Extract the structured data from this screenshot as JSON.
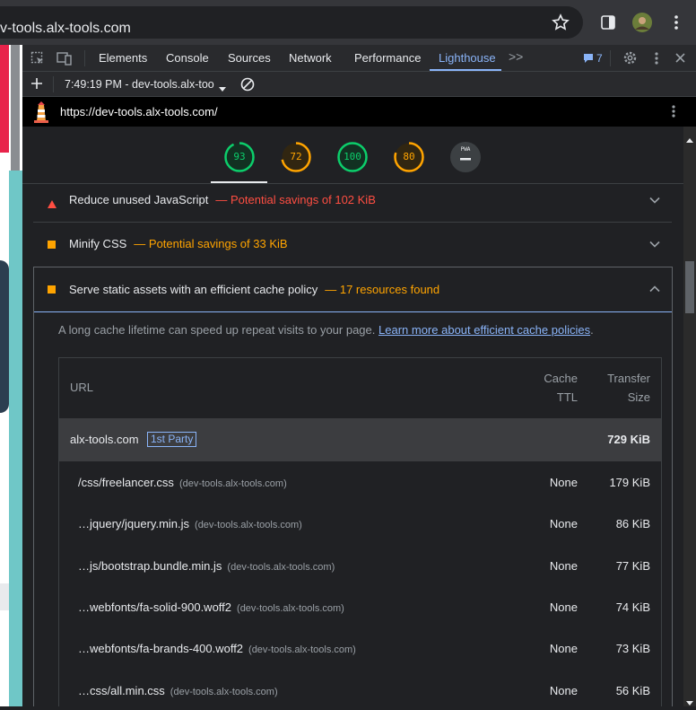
{
  "browser": {
    "url": "v-tools.alx-tools.com"
  },
  "devtools": {
    "tabs": [
      "Elements",
      "Console",
      "Sources",
      "Network",
      "Performance",
      "Lighthouse"
    ],
    "active_tab": "Lighthouse",
    "more_tabs_icon": ">>",
    "issues_count": "7",
    "report_selector": "7:49:19 PM - dev-tools.alx-too"
  },
  "lighthouse": {
    "report_url": "https://dev-tools.alx-tools.com/",
    "gauges": [
      {
        "value": "93",
        "color": "#0cce6b",
        "fraction": 0.93
      },
      {
        "value": "72",
        "color": "#ffa400",
        "fraction": 0.72
      },
      {
        "value": "100",
        "color": "#0cce6b",
        "fraction": 1.0
      },
      {
        "value": "80",
        "color": "#ffa400",
        "fraction": 0.8
      },
      {
        "value": "PWA",
        "color": "#9aa0a6",
        "fraction": 0
      }
    ],
    "audits": [
      {
        "title": "Reduce unused JavaScript",
        "detail": "— Potential savings of 102 KiB",
        "severity": "fail",
        "detail_color": "#ff4e42"
      },
      {
        "title": "Minify CSS",
        "detail": "— Potential savings of 33 KiB",
        "severity": "average",
        "detail_color": "#ffa400"
      },
      {
        "title": "Serve static assets with an efficient cache policy",
        "detail": "— 17 resources found",
        "severity": "average",
        "detail_color": "#ffa400"
      }
    ],
    "cache_description": "A long cache lifetime can speed up repeat visits to your page.",
    "cache_link": "Learn more about efficient cache policies",
    "cache_description_end": ".",
    "table": {
      "col_url": "URL",
      "col_ttl_1": "Cache",
      "col_ttl_2": "TTL",
      "col_size_1": "Transfer",
      "col_size_2": "Size",
      "group_host": "alx-tools.com",
      "group_badge": "1st Party",
      "group_size": "729 KiB",
      "rows": [
        {
          "url": "/css/freelancer.css",
          "host": "(dev-tools.alx-tools.com)",
          "ttl": "None",
          "size": "179 KiB"
        },
        {
          "url": "…jquery/jquery.min.js",
          "host": "(dev-tools.alx-tools.com)",
          "ttl": "None",
          "size": "86 KiB"
        },
        {
          "url": "…js/bootstrap.bundle.min.js",
          "host": "(dev-tools.alx-tools.com)",
          "ttl": "None",
          "size": "77 KiB"
        },
        {
          "url": "…webfonts/fa-solid-900.woff2",
          "host": "(dev-tools.alx-tools.com)",
          "ttl": "None",
          "size": "74 KiB"
        },
        {
          "url": "…webfonts/fa-brands-400.woff2",
          "host": "(dev-tools.alx-tools.com)",
          "ttl": "None",
          "size": "73 KiB"
        },
        {
          "url": "…css/all.min.css",
          "host": "(dev-tools.alx-tools.com)",
          "ttl": "None",
          "size": "56 KiB"
        }
      ]
    }
  },
  "colors": {
    "accent": "#8ab4f8",
    "pass": "#0cce6b",
    "average": "#ffa400",
    "fail": "#ff4e42"
  }
}
